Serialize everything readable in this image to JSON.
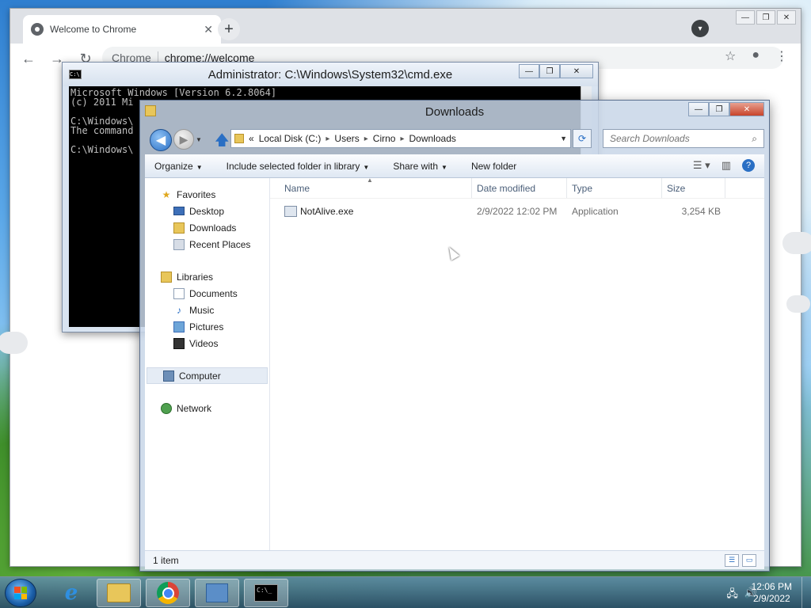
{
  "chrome": {
    "tab_title": "Welcome to Chrome",
    "tab_close": "✕",
    "new_tab": "+",
    "omnibox_chip": "Chrome",
    "omnibox_url": "chrome://welcome",
    "back": "←",
    "forward": "→",
    "reload": "↻",
    "star": "☆",
    "menu": "⋮",
    "win_buttons": [
      "—",
      "❐",
      "✕"
    ]
  },
  "cmd": {
    "title": "Administrator: C:\\Windows\\System32\\cmd.exe",
    "lines": [
      "Microsoft Windows [Version 6.2.8064]",
      "(c) 2011 Mi",
      "",
      "C:\\Windows\\",
      "The command",
      "",
      "C:\\Windows\\"
    ],
    "win_buttons": [
      "—",
      "❐",
      "✕"
    ]
  },
  "explorer": {
    "title": "Downloads",
    "win_buttons": [
      "—",
      "❐",
      "✕"
    ],
    "address": {
      "crumbs": [
        "«",
        "Local Disk (C:)",
        "Users",
        "Cirno",
        "Downloads"
      ]
    },
    "search": {
      "placeholder": "Search Downloads"
    },
    "commands": {
      "organize": "Organize",
      "include": "Include selected folder in library",
      "share": "Share with",
      "new_folder": "New folder"
    },
    "nav": {
      "favorites": "Favorites",
      "desktop": "Desktop",
      "downloads": "Downloads",
      "recent": "Recent Places",
      "libraries": "Libraries",
      "documents": "Documents",
      "music": "Music",
      "pictures": "Pictures",
      "videos": "Videos",
      "computer": "Computer",
      "network": "Network"
    },
    "columns": {
      "name": "Name",
      "date": "Date modified",
      "type": "Type",
      "size": "Size"
    },
    "files": [
      {
        "name": "NotAlive.exe",
        "date": "2/9/2022 12:02 PM",
        "type": "Application",
        "size": "3,254 KB"
      }
    ],
    "status": "1 item"
  },
  "taskbar": {
    "ie_label": "e",
    "clock_time": "12:06 PM",
    "clock_date": "2/9/2022",
    "cmd_icon_text": "C:\\_"
  }
}
